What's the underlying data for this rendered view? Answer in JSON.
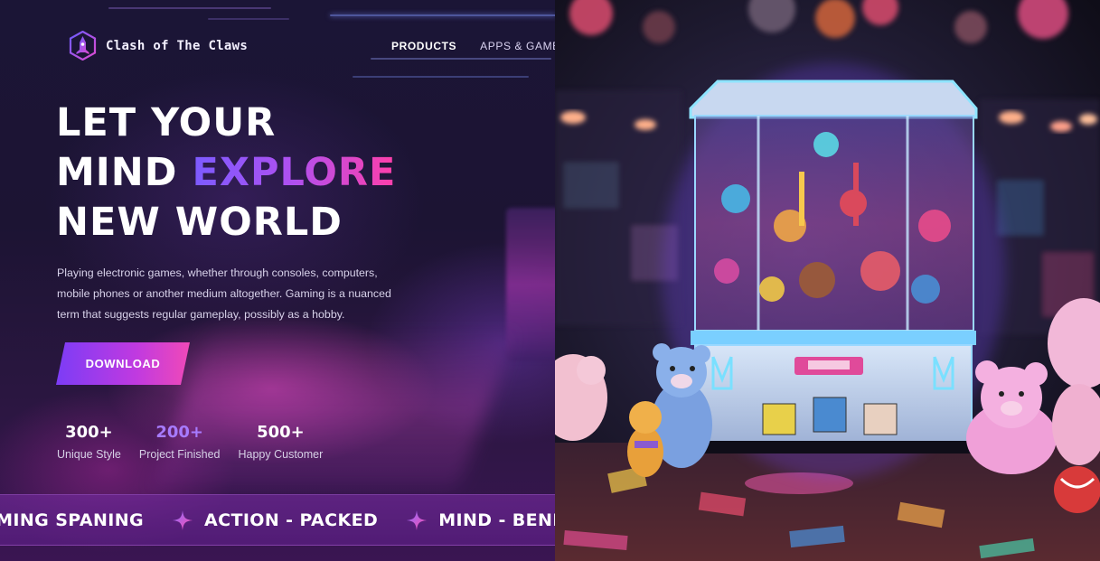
{
  "brand": {
    "name": "Clash of The Claws",
    "logo_icon": "rocket-emblem-icon"
  },
  "nav": {
    "items": [
      {
        "label": "PRODUCTS",
        "active": true
      },
      {
        "label": "APPS & GAMES",
        "active": false
      }
    ]
  },
  "hero": {
    "headline_line1": "LET YOUR",
    "headline_line2_prefix": "MIND ",
    "headline_line2_highlight": "EXPLORE",
    "headline_line3": "NEW WORLD",
    "description_line1": "Playing electronic games, whether through consoles, computers,",
    "description_line2": "mobile phones or another medium altogether. Gaming is a nuanced",
    "description_line3": "term that suggests regular gameplay, possibly as a hobby.",
    "cta_label": "DOWNLOAD"
  },
  "stats": [
    {
      "value": "300+",
      "label": "Unique Style",
      "accent": false
    },
    {
      "value": "200+",
      "label": "Project Finished",
      "accent": true
    },
    {
      "value": "500+",
      "label": "Happy Customer",
      "accent": false
    }
  ],
  "marquee": {
    "items": [
      "AMING SPANING",
      "ACTION - PACKED",
      "MIND - BENDI"
    ],
    "separator_icon": "sparkle-icon"
  },
  "colors": {
    "accent_purple": "#7b5bff",
    "accent_pink": "#ff3fa9",
    "background": "#1b1536"
  }
}
